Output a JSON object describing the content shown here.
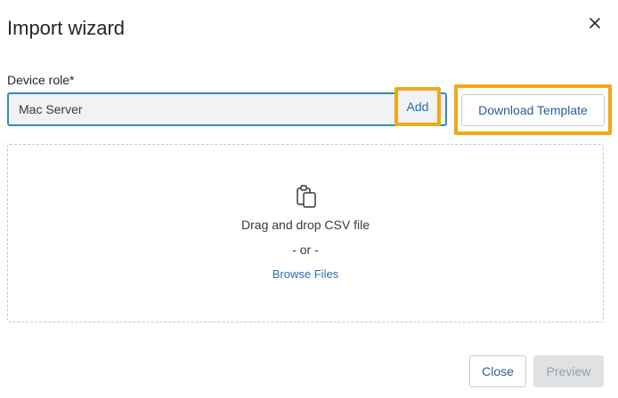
{
  "dialog": {
    "title": "Import wizard",
    "close_icon": "close-icon"
  },
  "device_role": {
    "label": "Device role*",
    "value": "Mac Server",
    "add_label": "Add"
  },
  "download_template_label": "Download Template",
  "dropzone": {
    "icon": "clipboard-icon",
    "instruction": "Drag and drop CSV file",
    "separator": "- or -",
    "browse_label": "Browse Files"
  },
  "footer": {
    "close_label": "Close",
    "preview_label": "Preview"
  },
  "colors": {
    "accent": "#2a6fb0",
    "highlight": "#f0a81a",
    "input_border": "#2f8fb8",
    "disabled_bg": "#dfe1e3"
  }
}
